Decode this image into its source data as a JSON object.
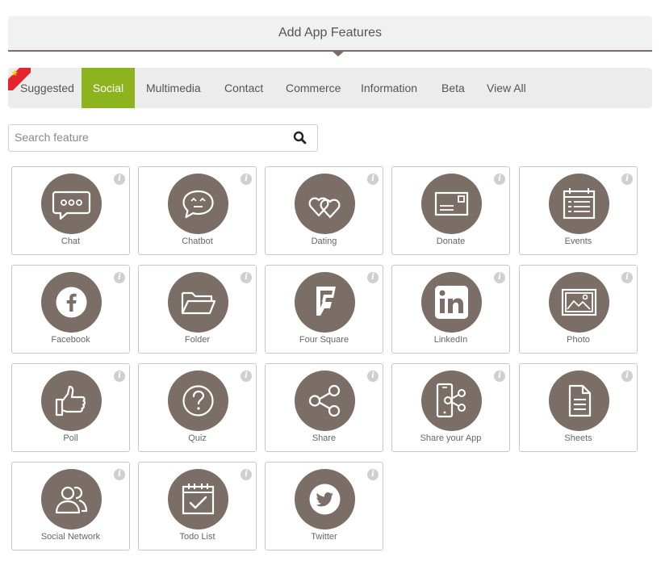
{
  "header": {
    "title": "Add App Features"
  },
  "tabs": [
    {
      "label": "Suggested"
    },
    {
      "label": "Social"
    },
    {
      "label": "Multimedia"
    },
    {
      "label": "Contact"
    },
    {
      "label": "Commerce"
    },
    {
      "label": "Information"
    },
    {
      "label": "Beta"
    },
    {
      "label": "View All"
    }
  ],
  "active_tab": "Social",
  "search": {
    "placeholder": "Search feature",
    "value": ""
  },
  "features": [
    {
      "label": "Chat",
      "icon": "chat-icon"
    },
    {
      "label": "Chatbot",
      "icon": "chatbot-icon"
    },
    {
      "label": "Dating",
      "icon": "hearts-icon"
    },
    {
      "label": "Donate",
      "icon": "donate-icon"
    },
    {
      "label": "Events",
      "icon": "calendar-icon"
    },
    {
      "label": "Facebook",
      "icon": "facebook-icon"
    },
    {
      "label": "Folder",
      "icon": "folder-icon"
    },
    {
      "label": "Four Square",
      "icon": "foursquare-icon"
    },
    {
      "label": "LinkedIn",
      "icon": "linkedin-icon"
    },
    {
      "label": "Photo",
      "icon": "photo-icon"
    },
    {
      "label": "Poll",
      "icon": "thumbs-up-icon"
    },
    {
      "label": "Quiz",
      "icon": "question-icon"
    },
    {
      "label": "Share",
      "icon": "share-icon"
    },
    {
      "label": "Share your App",
      "icon": "share-app-icon"
    },
    {
      "label": "Sheets",
      "icon": "document-icon"
    },
    {
      "label": "Social Network",
      "icon": "users-icon"
    },
    {
      "label": "Todo List",
      "icon": "todo-calendar-icon"
    },
    {
      "label": "Twitter",
      "icon": "twitter-icon"
    }
  ],
  "info_glyph": "i",
  "colors": {
    "accent": "#8db41e",
    "icon_bg": "#7a6e66",
    "ribbon": "#e3262d"
  }
}
